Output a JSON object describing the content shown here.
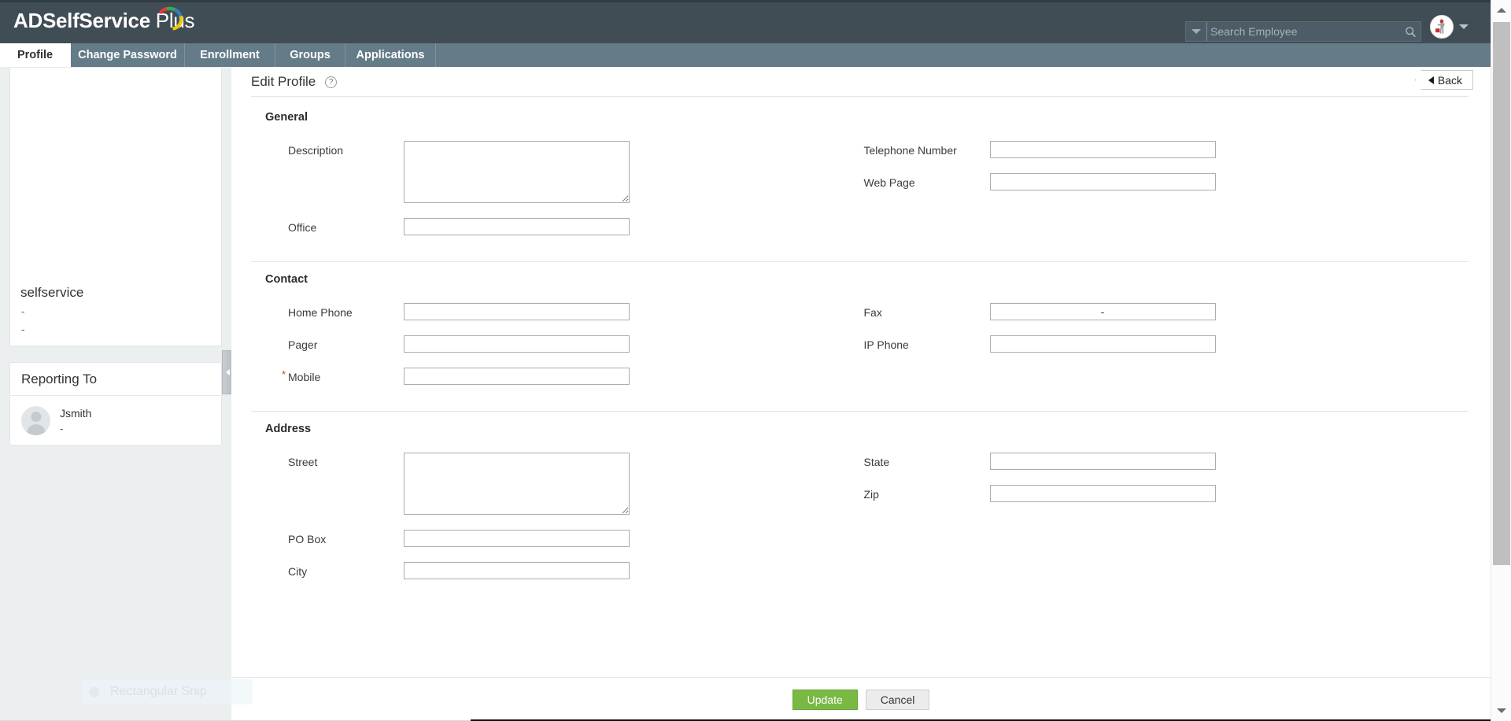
{
  "header": {
    "brand_main": "ADSelfService",
    "brand_plus": " Plus",
    "logo_icon": "swoosh-logo-icon",
    "search": {
      "placeholder": "Search Employee",
      "value": "",
      "caret_icon": "chevron-down-icon",
      "search_icon": "search-icon"
    },
    "user": {
      "avatar_icon": "user-avatar-icon",
      "caret_icon": "chevron-down-icon"
    }
  },
  "tabs": [
    {
      "label": "Profile",
      "active": true
    },
    {
      "label": "Change Password",
      "active": false
    },
    {
      "label": "Enrollment",
      "active": false
    },
    {
      "label": "Groups",
      "active": false
    },
    {
      "label": "Applications",
      "active": false
    }
  ],
  "sidebar": {
    "profile": {
      "name": "selfservice",
      "line1": "-",
      "line2": "-"
    },
    "reporting": {
      "title": "Reporting To",
      "person_name": "Jsmith",
      "person_sub": "-",
      "avatar_icon": "user-placeholder-icon"
    },
    "collapse_handle_icon": "chevron-left-icon"
  },
  "main": {
    "title": "Edit Profile",
    "help_icon": "question-mark-icon",
    "help_label": "?",
    "back_button": {
      "label": "Back",
      "icon": "chevron-left-icon"
    },
    "sections": [
      {
        "title": "General",
        "left_fields": [
          {
            "label": "Description",
            "type": "textarea",
            "value": "",
            "required": false
          },
          {
            "label": "Office",
            "type": "input",
            "value": "",
            "required": false
          }
        ],
        "right_fields": [
          {
            "label": "Telephone Number",
            "type": "input",
            "value": "",
            "required": false
          },
          {
            "label": "Web Page",
            "type": "input",
            "value": "",
            "required": false
          }
        ]
      },
      {
        "title": "Contact",
        "left_fields": [
          {
            "label": "Home Phone",
            "type": "input",
            "value": "",
            "required": false
          },
          {
            "label": "Pager",
            "type": "input",
            "value": "",
            "required": false
          },
          {
            "label": "Mobile",
            "type": "input",
            "value": "",
            "required": true
          }
        ],
        "right_fields": [
          {
            "label": "Fax",
            "type": "input",
            "value": "-",
            "required": false
          },
          {
            "label": "IP Phone",
            "type": "input",
            "value": "",
            "required": false
          }
        ]
      },
      {
        "title": "Address",
        "left_fields": [
          {
            "label": "Street",
            "type": "textarea",
            "value": "",
            "required": false
          },
          {
            "label": "PO Box",
            "type": "input",
            "value": "",
            "required": false
          },
          {
            "label": "City",
            "type": "input",
            "value": "",
            "required": false
          }
        ],
        "right_fields": [
          {
            "label": "State",
            "type": "input",
            "value": "",
            "required": false
          },
          {
            "label": "Zip",
            "type": "input",
            "value": "",
            "required": false
          }
        ]
      }
    ],
    "footer": {
      "update_label": "Update",
      "cancel_label": "Cancel"
    }
  },
  "overlay": {
    "snip_label": "Rectangular Snip",
    "snip_icon": "snip-dot-icon"
  },
  "scrollbar": {
    "up_icon": "scroll-up-arrow-icon",
    "down_icon": "scroll-down-arrow-icon"
  },
  "colors": {
    "header_bg": "#414d55",
    "tabbar_bg": "#647b88",
    "page_bg": "#eceff0",
    "accent_green": "#78b843",
    "required_red": "#e03e1a"
  }
}
